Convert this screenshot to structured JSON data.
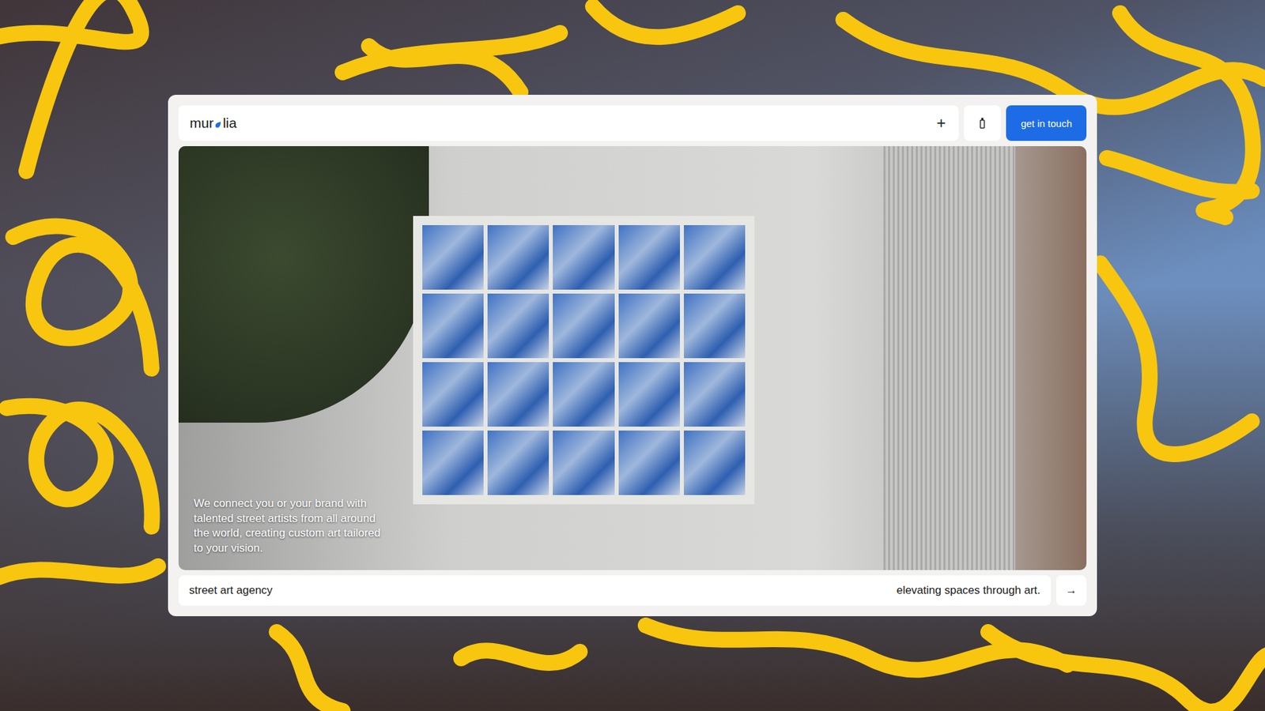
{
  "nav": {
    "logo": {
      "before": "mur",
      "after": "lia"
    },
    "menu_icon": "+",
    "cta": "get in touch"
  },
  "hero": {
    "caption": "We connect you or your brand with talented street artists from all around the world, creating custom art tailored to your vision."
  },
  "footer_bar": {
    "left": "street art agency",
    "right": "elevating spaces through art.",
    "arrow": "→"
  }
}
